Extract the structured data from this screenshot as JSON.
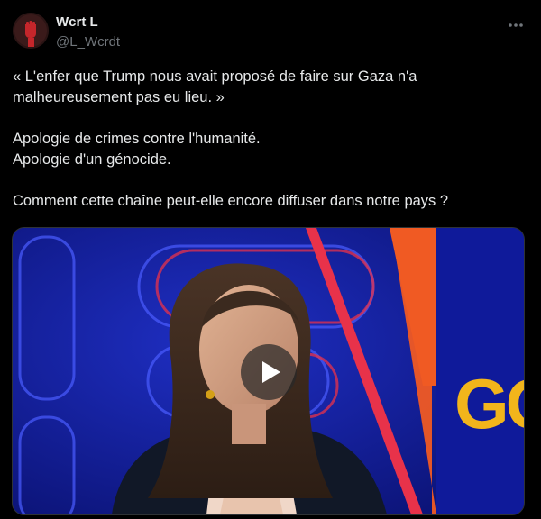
{
  "author": {
    "display_name": "Wcrt L",
    "handle": "@L_Wcrdt",
    "avatar_icon": "raised-fist-icon"
  },
  "tweet": {
    "lines": [
      "« L'enfer que Trump nous avait proposé de faire sur Gaza n'a",
      "malheureusement pas eu lieu. »",
      "Apologie de crimes contre l'humanité.",
      "Apologie d'un génocide.",
      "Comment cette chaîne peut-elle encore diffuser dans notre pays ?"
    ]
  },
  "media": {
    "type": "video",
    "play_icon": "play-icon",
    "studio_text": "GG",
    "colors": {
      "background": "#101a8a",
      "neon": "#e8324a",
      "orange": "#f05a23",
      "logo": "#f2b51b"
    }
  },
  "more_icon": "more-horizontal-icon"
}
